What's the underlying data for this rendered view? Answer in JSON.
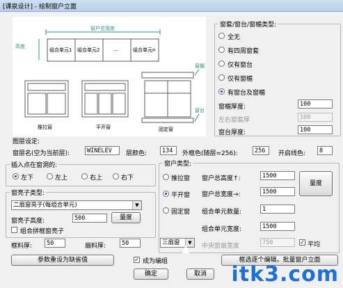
{
  "title": "[课泉设计] - 绘制窗户立面",
  "preview": {
    "width_label": "窗户总宽度",
    "height_label": "高度",
    "units": [
      "组合单元1",
      "组合单元2",
      "...",
      "组合单元n"
    ],
    "canopy_label": "窗楣",
    "sill_label": "窗台",
    "captions": [
      "推拉窗",
      "平开窗",
      "固定窗"
    ]
  },
  "frame_type": {
    "legend": "窗套/窗台/窗楣类型:",
    "options": [
      "全无",
      "有四周窗套",
      "仅有窗台",
      "仅有窗楣",
      "有窗台及窗楣"
    ],
    "selected": 4
  },
  "thickness": {
    "canopy_label": "窗楣厚度:",
    "canopy_value": "100",
    "side_label": "左右窗套厚",
    "side_value": "100",
    "sill_label": "窗台厚度:",
    "sill_value": "100"
  },
  "layer": {
    "section": "图层设定:",
    "name_label": "窗层名(空为当前层):",
    "name_value": "WINELEV",
    "color_label": "层颜色:",
    "color_value": "134",
    "frame_color_label": "外框色(随层=256):",
    "frame_color_value": "256",
    "linetype_label": "开启线色:",
    "linetype_value": "8"
  },
  "insert_point": {
    "legend": "插入点在窗洞的:",
    "options": [
      "左下",
      "左上",
      "右上",
      "右下"
    ],
    "selected": 0
  },
  "sash": {
    "legend": "窗亮子类型:",
    "selected": "二扇窗亮子(每组合单元)",
    "height_label": "窗亮子高度:",
    "height_value": "500",
    "measure_button": "量度",
    "combine_label": "组合拼框窗亮子",
    "frame_thick_label": "框料厚:",
    "frame_thick_value": "50",
    "sash_thick_label": "扇料厚:",
    "sash_thick_value": "50"
  },
  "window_type": {
    "legend": "窗户类型:",
    "options": [
      "推拉窗",
      "平开窗",
      "固定窗"
    ],
    "selected": 1,
    "total_height_label": "窗户总高度↑:",
    "total_height_value": "1500",
    "total_width_label": "窗户总宽度→:",
    "total_width_value": "1500",
    "measure_button": "量度",
    "unit_count_label": "组合单元数量:",
    "unit_count_value": "1",
    "unit_width_label": "组合单元宽度:",
    "unit_width_value": "1500",
    "leaf_select": "三扇窗",
    "mullion_label": "中央窗扇宽度",
    "mullion_value": "750",
    "average_label": "平均"
  },
  "bottom": {
    "reset_button": "参数重设为缺省值",
    "group_label": "成为编组",
    "ok_button": "确定",
    "cancel_button": "取消",
    "batch_button": "框选逐个编辑，批量窗户立面"
  },
  "watermark": "itk3.com"
}
